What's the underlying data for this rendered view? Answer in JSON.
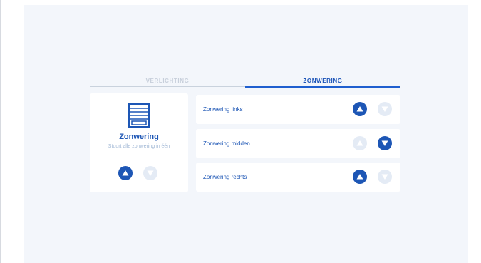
{
  "tabs": [
    {
      "label": "VERLICHTING",
      "active": false
    },
    {
      "label": "ZONWERING",
      "active": true
    }
  ],
  "master": {
    "icon": "window-blind-icon",
    "title": "Zonwering",
    "subtitle": "Stuurt alle zonwering in één"
  },
  "rows": [
    {
      "label": "Zonwering links",
      "up_active": true,
      "down_active": false
    },
    {
      "label": "Zonwering midden",
      "up_active": false,
      "down_active": true
    },
    {
      "label": "Zonwering rechts",
      "up_active": true,
      "down_active": false
    }
  ],
  "colors": {
    "accent": "#1d56b5",
    "inactive_button": "#e4ebf5",
    "panel_background": "#f3f6fb",
    "inactive_tab": "#c7cfdb"
  }
}
